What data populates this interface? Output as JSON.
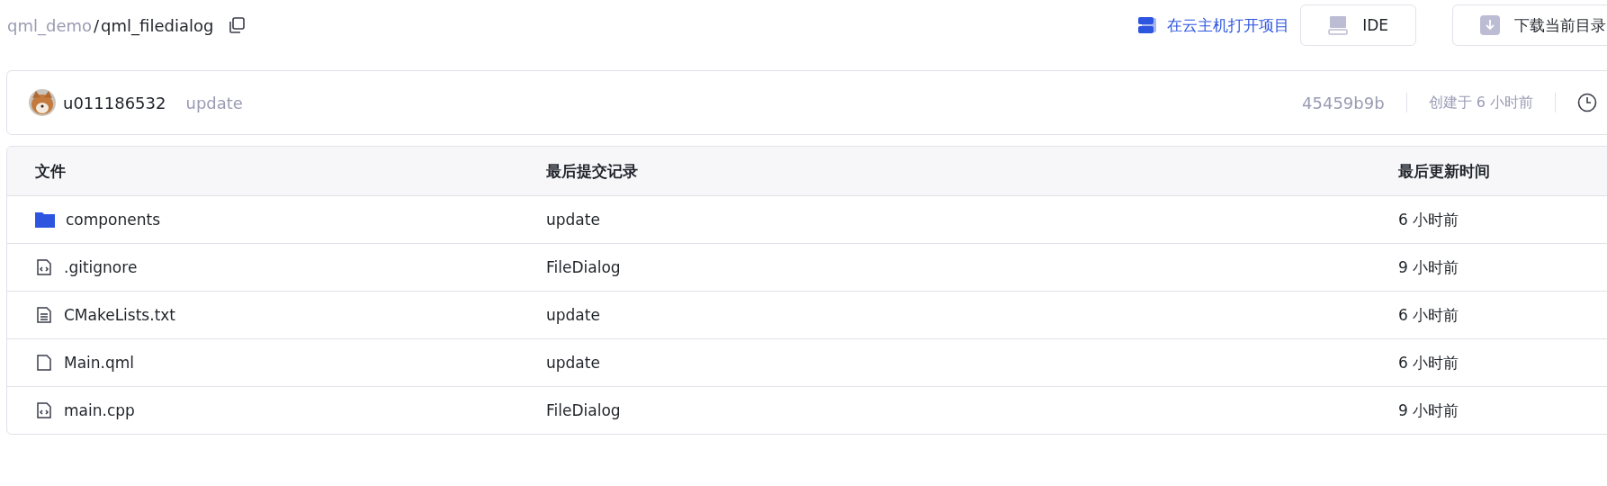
{
  "breadcrumb": {
    "parent": "qml_demo",
    "separator": "/",
    "current": "qml_filedialog"
  },
  "actions": {
    "cloud_link": "在云主机打开项目",
    "ide_button": "IDE",
    "download_button": "下载当前目录"
  },
  "commit_bar": {
    "author": "u011186532",
    "message": "update",
    "hash": "45459b9b",
    "created": "创建于 6 小时前"
  },
  "table": {
    "columns": [
      "文件",
      "最后提交记录",
      "最后更新时间"
    ],
    "rows": [
      {
        "kind": "folder",
        "name": "components",
        "commit": "update",
        "time": "6 小时前"
      },
      {
        "kind": "code",
        "name": ".gitignore",
        "commit": "FileDialog",
        "time": "9 小时前"
      },
      {
        "kind": "text",
        "name": "CMakeLists.txt",
        "commit": "update",
        "time": "6 小时前"
      },
      {
        "kind": "file",
        "name": "Main.qml",
        "commit": "update",
        "time": "6 小时前"
      },
      {
        "kind": "code",
        "name": "main.cpp",
        "commit": "FileDialog",
        "time": "9 小时前"
      }
    ]
  }
}
